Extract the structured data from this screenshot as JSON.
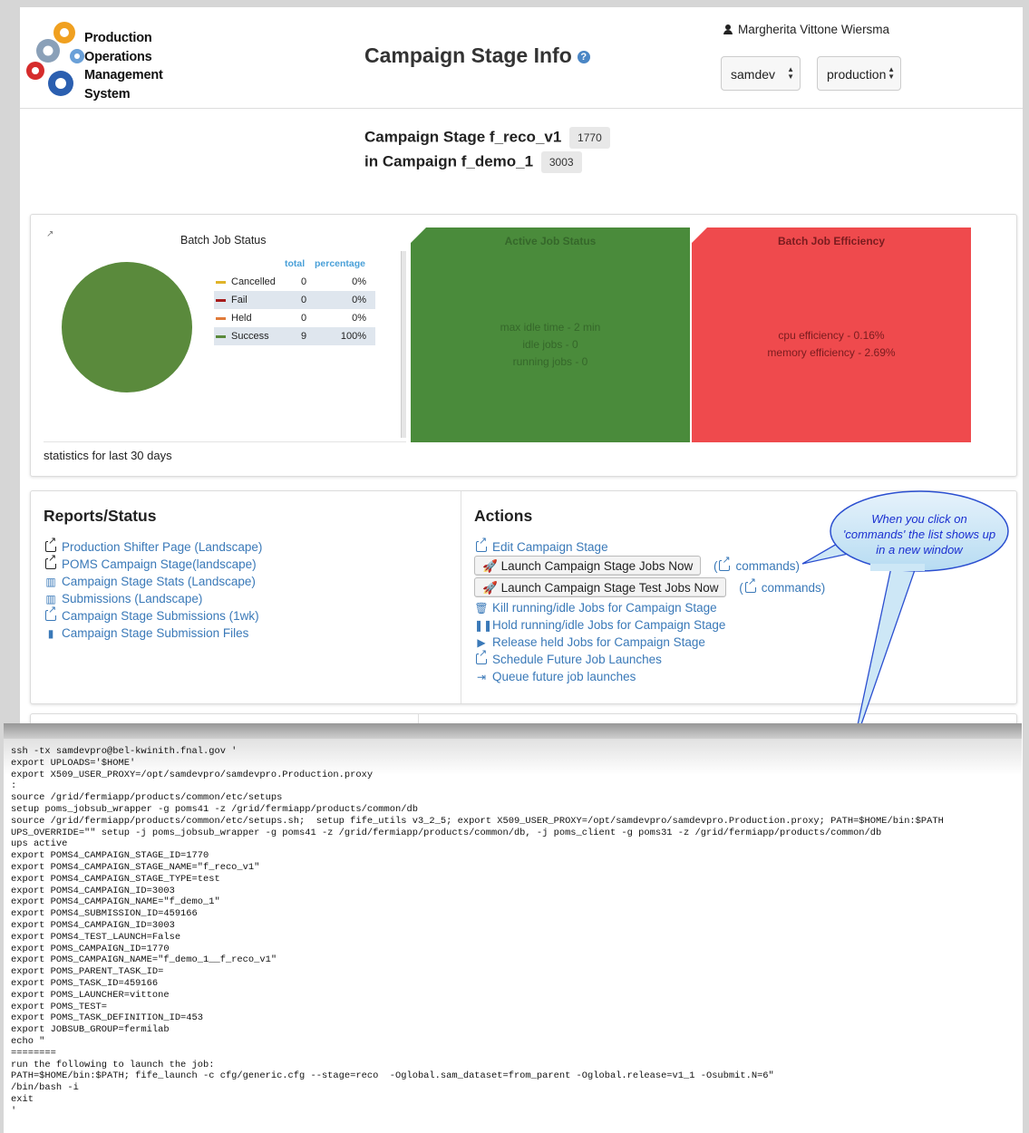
{
  "header": {
    "logo_lines": [
      "Production",
      "Operations",
      "Management",
      "System"
    ],
    "page_title": "Campaign Stage Info",
    "user_name": "Margherita Vittone Wiersma",
    "experiment_select": "samdev",
    "role_select": "production"
  },
  "stage": {
    "stage_prefix": "Campaign Stage f_reco_v1",
    "stage_id": "1770",
    "campaign_prefix": "in Campaign f_demo_1",
    "campaign_id": "3003"
  },
  "batch_job_status": {
    "title": "Batch Job Status",
    "col_total": "total",
    "col_percentage": "percentage",
    "rows": [
      {
        "label": "Cancelled",
        "total": "0",
        "percentage": "0%",
        "color": "#e0b42a"
      },
      {
        "label": "Fail",
        "total": "0",
        "percentage": "0%",
        "color": "#a61c1c"
      },
      {
        "label": "Held",
        "total": "0",
        "percentage": "0%",
        "color": "#e07b39"
      },
      {
        "label": "Success",
        "total": "9",
        "percentage": "100%",
        "color": "#5a8a3c"
      }
    ],
    "footer_note": "statistics for last 30 days"
  },
  "active_job_status": {
    "title": "Active Job Status",
    "lines": [
      "max idle time - 2 min",
      "idle jobs - 0",
      "running jobs - 0"
    ],
    "info": "i"
  },
  "batch_job_efficiency": {
    "title": "Batch Job Efficiency",
    "lines": [
      "cpu efficiency - 0.16%",
      "memory efficiency - 2.69%"
    ],
    "info": "i"
  },
  "reports": {
    "title": "Reports/Status",
    "links": [
      "Production Shifter Page (Landscape)",
      "POMS Campaign Stage(landscape)",
      "Campaign Stage Stats (Landscape)",
      "Submissions (Landscape)",
      "Campaign Stage Submissions (1wk)",
      "Campaign Stage Submission Files"
    ]
  },
  "actions": {
    "title": "Actions",
    "edit": "Edit Campaign Stage",
    "launch_now": "Launch Campaign Stage Jobs Now",
    "launch_test": "Launch Campaign Stage Test Jobs Now",
    "commands_open": "(",
    "commands": "commands)",
    "kill": "Kill running/idle Jobs for Campaign Stage",
    "hold": "Hold running/idle Jobs for Campaign Stage",
    "release": "Release held Jobs for Campaign Stage",
    "schedule": "Schedule Future Job Launches",
    "queue": "Queue future job launches"
  },
  "callout": {
    "lines": [
      "When you click on",
      "'commands' the list shows up",
      "in a new window"
    ]
  },
  "terminal": {
    "lines": [
      "ssh -tx samdevpro@bel-kwinith.fnal.gov '",
      "export UPLOADS='$HOME'",
      "export X509_USER_PROXY=/opt/samdevpro/samdevpro.Production.proxy",
      ":",
      "source /grid/fermiapp/products/common/etc/setups",
      "setup poms_jobsub_wrapper -g poms41 -z /grid/fermiapp/products/common/db",
      "source /grid/fermiapp/products/common/etc/setups.sh;  setup fife_utils v3_2_5; export X509_USER_PROXY=/opt/samdevpro/samdevpro.Production.proxy; PATH=$HOME/bin:$PATH",
      "UPS_OVERRIDE=\"\" setup -j poms_jobsub_wrapper -g poms41 -z /grid/fermiapp/products/common/db, -j poms_client -g poms31 -z /grid/fermiapp/products/common/db",
      "ups active",
      "export POMS4_CAMPAIGN_STAGE_ID=1770",
      "export POMS4_CAMPAIGN_STAGE_NAME=\"f_reco_v1\"",
      "export POMS4_CAMPAIGN_STAGE_TYPE=test",
      "export POMS4_CAMPAIGN_ID=3003",
      "export POMS4_CAMPAIGN_NAME=\"f_demo_1\"",
      "export POMS4_SUBMISSION_ID=459166",
      "export POMS4_CAMPAIGN_ID=3003",
      "export POMS4_TEST_LAUNCH=False",
      "export POMS_CAMPAIGN_ID=1770",
      "export POMS_CAMPAIGN_NAME=\"f_demo_1__f_reco_v1\"",
      "export POMS_PARENT_TASK_ID=",
      "export POMS_TASK_ID=459166",
      "export POMS_LAUNCHER=vittone",
      "export POMS_TEST=",
      "export POMS_TASK_DEFINITION_ID=453",
      "export JOBSUB_GROUP=fermilab",
      "echo \"",
      "========",
      "run the following to launch the job:",
      "PATH=$HOME/bin:$PATH; fife_launch -c cfg/generic.cfg --stage=reco  -Oglobal.sam_dataset=from_parent -Oglobal.release=v1_1 -Osubmit.N=6\"",
      "/bin/bash -i",
      "exit",
      "'"
    ]
  }
}
